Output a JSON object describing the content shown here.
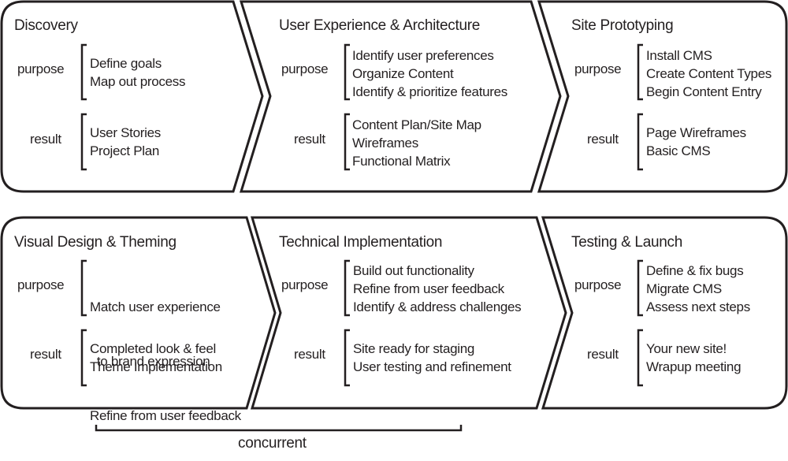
{
  "diagram": {
    "rows": [
      {
        "stages": [
          {
            "title": "Discovery",
            "purpose_label": "purpose",
            "purpose": [
              "Define goals",
              "Map out process"
            ],
            "result_label": "result",
            "result": [
              "User Stories",
              "Project Plan"
            ]
          },
          {
            "title": "User Experience & Architecture",
            "purpose_label": "purpose",
            "purpose": [
              "Identify user preferences",
              "Organize Content",
              "Identify & prioritize features"
            ],
            "result_label": "result",
            "result": [
              "Content Plan/Site Map",
              "Wireframes",
              "Functional Matrix"
            ]
          },
          {
            "title": "Site Prototyping",
            "purpose_label": "purpose",
            "purpose": [
              "Install CMS",
              "Create Content Types",
              "Begin Content Entry"
            ],
            "result_label": "result",
            "result": [
              "Page Wireframes",
              "Basic CMS"
            ]
          }
        ]
      },
      {
        "stages": [
          {
            "title": "Visual Design & Theming",
            "purpose_label": "purpose",
            "purpose": [
              "Match user experience",
              "  to brand expression",
              "Refine from user feedback"
            ],
            "result_label": "result",
            "result": [
              "Completed look & feel",
              "Theme Implementation"
            ]
          },
          {
            "title": "Technical Implementation",
            "purpose_label": "purpose",
            "purpose": [
              "Build out functionality",
              "Refine from user feedback",
              "Identify & address challenges"
            ],
            "result_label": "result",
            "result": [
              "Site ready for staging",
              "User testing and refinement"
            ]
          },
          {
            "title": "Testing & Launch",
            "purpose_label": "purpose",
            "purpose": [
              "Define & fix bugs",
              "Migrate CMS",
              "Assess next steps"
            ],
            "result_label": "result",
            "result": [
              "Your new site!",
              "Wrapup meeting"
            ]
          }
        ]
      }
    ],
    "concurrent_label": "concurrent"
  }
}
